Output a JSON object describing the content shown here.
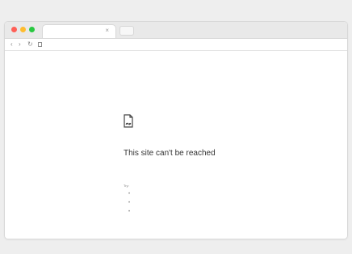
{
  "browser": {
    "tab": {
      "title": "",
      "close_label": "×"
    },
    "toolbar": {
      "back_icon": "‹",
      "forward_icon": "›",
      "reload_icon": "↻",
      "address": ""
    }
  },
  "error_page": {
    "title": "This site can't be reached",
    "subtitle": "",
    "try_label": "Try:",
    "suggestions": [
      {
        "label": ""
      },
      {
        "label": ""
      },
      {
        "label": ""
      }
    ],
    "error_code": ""
  },
  "colors": {
    "link_blue": "#2f63c9"
  }
}
